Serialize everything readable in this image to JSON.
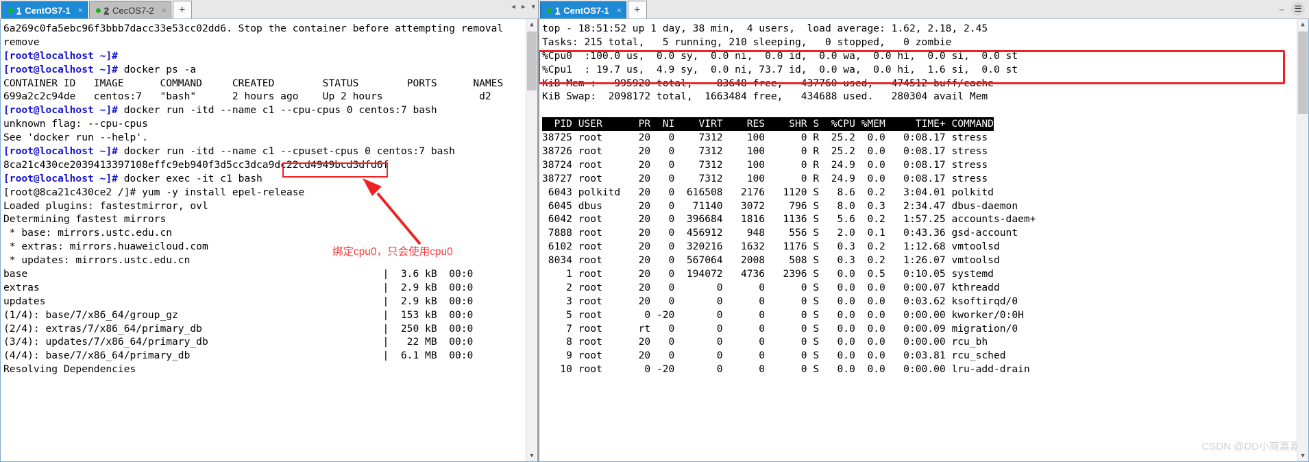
{
  "left_window": {
    "tabs": [
      {
        "num": "1",
        "label": "CentOS7-1",
        "active": true,
        "close": "×"
      },
      {
        "num": "2",
        "label": "CecOS7-2",
        "active": false,
        "close": "×"
      }
    ],
    "new_tab_label": "+",
    "nav": {
      "prev": "◂",
      "next": "▸",
      "list": "▾"
    },
    "terminal_lines": [
      {
        "text": "6a269c0fa5ebc96f3bbb7dacc33e53cc02dd6. Stop the container before attempting removal",
        "prompt": false
      },
      {
        "text": "remove",
        "prompt": false
      },
      {
        "text": "[root@localhost ~]#",
        "prompt": true
      },
      {
        "text": "[root@localhost ~]# docker ps -a",
        "prompt": true,
        "cmd": "docker ps -a"
      },
      {
        "text": "CONTAINER ID   IMAGE      COMMAND     CREATED        STATUS        PORTS      NAMES",
        "prompt": false
      },
      {
        "text": "699a2c2c94de   centos:7   \"bash\"      2 hours ago    Up 2 hours                d2",
        "prompt": false
      },
      {
        "text": "[root@localhost ~]# docker run -itd --name c1 --cpu-cpus 0 centos:7 bash",
        "prompt": true,
        "cmd": "docker run -itd --name c1 --cpu-cpus 0 centos:7 bash"
      },
      {
        "text": "unknown flag: --cpu-cpus",
        "prompt": false
      },
      {
        "text": "See 'docker run --help'.",
        "prompt": false
      },
      {
        "text": "[root@localhost ~]# docker run -itd --name c1 --cpuset-cpus 0 centos:7 bash",
        "prompt": true,
        "cmd": "docker run -itd --name c1 --cpuset-cpus 0 centos:7 bash"
      },
      {
        "text": "8ca21c430ce2039413397108effc9eb940f3d5cc3dca9dc22cd4949bcd3dfd6f",
        "prompt": false
      },
      {
        "text": "[root@localhost ~]# docker exec -it c1 bash",
        "prompt": true,
        "cmd": "docker exec -it c1 bash"
      },
      {
        "text": "[root@8ca21c430ce2 /]# yum -y install epel-release",
        "prompt": false
      },
      {
        "text": "Loaded plugins: fastestmirror, ovl",
        "prompt": false
      },
      {
        "text": "Determining fastest mirrors",
        "prompt": false
      },
      {
        "text": " * base: mirrors.ustc.edu.cn",
        "prompt": false
      },
      {
        "text": " * extras: mirrors.huaweicloud.com",
        "prompt": false
      },
      {
        "text": " * updates: mirrors.ustc.edu.cn",
        "prompt": false
      },
      {
        "text": "base                                                           |  3.6 kB  00:0",
        "prompt": false
      },
      {
        "text": "extras                                                         |  2.9 kB  00:0",
        "prompt": false
      },
      {
        "text": "updates                                                        |  2.9 kB  00:0",
        "prompt": false
      },
      {
        "text": "(1/4): base/7/x86_64/group_gz                                  |  153 kB  00:0",
        "prompt": false
      },
      {
        "text": "(2/4): extras/7/x86_64/primary_db                              |  250 kB  00:0",
        "prompt": false
      },
      {
        "text": "(3/4): updates/7/x86_64/primary_db                             |   22 MB  00:0",
        "prompt": false
      },
      {
        "text": "(4/4): base/7/x86_64/primary_db                                |  6.1 MB  00:0",
        "prompt": false
      },
      {
        "text": "Resolving Dependencies",
        "prompt": false
      }
    ],
    "annotation": {
      "text": "绑定cpu0，只会使用cpu0",
      "color": "#fa3c3c"
    },
    "highlight_color": "#ee2222",
    "highlighted_flag": "--cpuset-cpus 0"
  },
  "right_window": {
    "tabs": [
      {
        "num": "1",
        "label": "CentOS7-1",
        "active": true,
        "close": "×"
      }
    ],
    "new_tab_label": "+",
    "window_controls": {
      "minimize": "–",
      "maximize": "□",
      "close": "✕",
      "menu": "⬤"
    },
    "top_summary": [
      "top - 18:51:52 up 1 day, 38 min,  4 users,  load average: 1.62, 2.18, 2.45",
      "Tasks: 215 total,   5 running, 210 sleeping,   0 stopped,   0 zombie",
      "%Cpu0  :100.0 us,  0.0 sy,  0.0 ni,  0.0 id,  0.0 wa,  0.0 hi,  0.0 si,  0.0 st",
      "%Cpu1  : 19.7 us,  4.9 sy,  0.0 ni, 73.7 id,  0.0 wa,  0.0 hi,  1.6 si,  0.0 st",
      "KiB Mem :   995920 total,    83648 free,   437760 used,   474512 buff/cache",
      "KiB Swap:  2098172 total,  1663484 free,   434688 used.   280304 avail Mem"
    ],
    "table_header": "  PID USER      PR  NI    VIRT    RES    SHR S  %CPU %MEM     TIME+ COMMAND",
    "table_rows": [
      "38725 root      20   0    7312    100      0 R  25.2  0.0   0:08.17 stress",
      "38726 root      20   0    7312    100      0 R  25.2  0.0   0:08.17 stress",
      "38724 root      20   0    7312    100      0 R  24.9  0.0   0:08.17 stress",
      "38727 root      20   0    7312    100      0 R  24.9  0.0   0:08.17 stress",
      " 6043 polkitd   20   0  616508   2176   1120 S   8.6  0.2   3:04.01 polkitd",
      " 6045 dbus      20   0   71140   3072    796 S   8.0  0.3   2:34.47 dbus-daemon",
      " 6042 root      20   0  396684   1816   1136 S   5.6  0.2   1:57.25 accounts-daem+",
      " 7888 root      20   0  456912    948    556 S   2.0  0.1   0:43.36 gsd-account",
      " 6102 root      20   0  320216   1632   1176 S   0.3  0.2   1:12.68 vmtoolsd",
      " 8034 root      20   0  567064   2008    508 S   0.3  0.2   1:26.07 vmtoolsd",
      "    1 root      20   0  194072   4736   2396 S   0.0  0.5   0:10.05 systemd",
      "    2 root      20   0       0      0      0 S   0.0  0.0   0:00.07 kthreadd",
      "    3 root      20   0       0      0      0 S   0.0  0.0   0:03.62 ksoftirqd/0",
      "    5 root       0 -20       0      0      0 S   0.0  0.0   0:00.00 kworker/0:0H",
      "    7 root      rt   0       0      0      0 S   0.0  0.0   0:00.09 migration/0",
      "    8 root      20   0       0      0      0 S   0.0  0.0   0:00.00 rcu_bh",
      "    9 root      20   0       0      0      0 S   0.0  0.0   0:03.81 rcu_sched",
      "   10 root       0 -20       0      0      0 S   0.0  0.0   0:00.00 lru-add-drain"
    ],
    "highlight_color": "#ee2222",
    "watermark": "CSDN @DD小商嘉嘉"
  }
}
